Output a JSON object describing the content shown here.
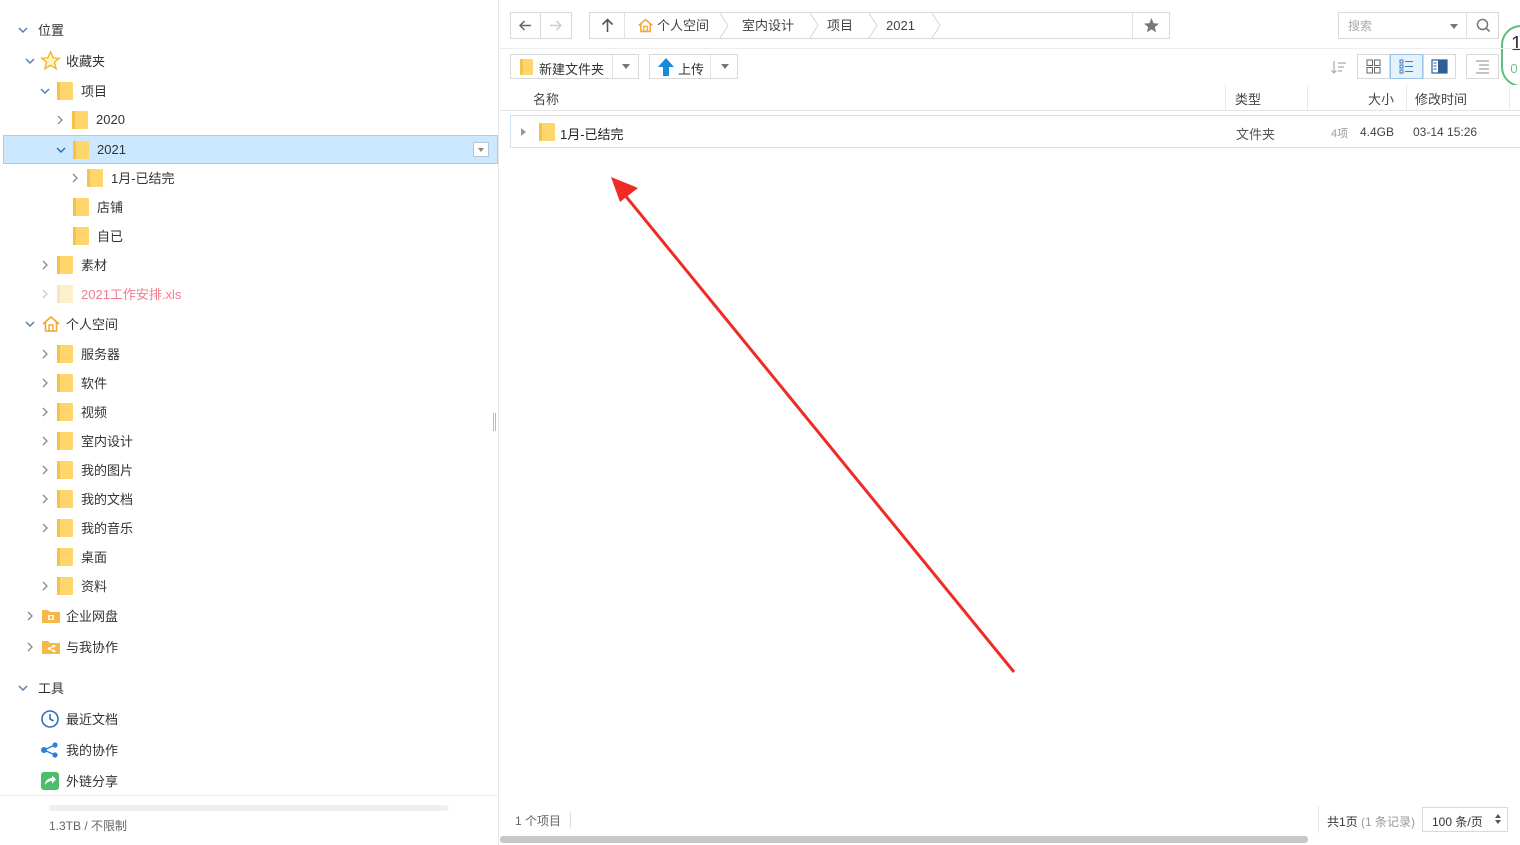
{
  "sidebar": {
    "locations_header": "位置",
    "favorites": "收藏夹",
    "fav_project": "项目",
    "fav_2020": "2020",
    "fav_2021": "2021",
    "fav_jan": "1月-已结完",
    "fav_shop": "店铺",
    "fav_self": "自已",
    "fav_material": "素材",
    "fav_xls": "2021工作安排.xls",
    "personal": "个人空间",
    "p_server": "服务器",
    "p_software": "软件",
    "p_video": "视频",
    "p_interior": "室内设计",
    "p_pictures": "我的图片",
    "p_docs": "我的文档",
    "p_music": "我的音乐",
    "p_desktop": "桌面",
    "p_resources": "资料",
    "enterprise": "企业网盘",
    "shared_with_me": "与我协作",
    "tools_header": "工具",
    "recent_docs": "最近文档",
    "my_collab": "我的协作",
    "external_share": "外链分享",
    "storage": "1.3TB / 不限制"
  },
  "breadcrumb": {
    "home": "个人空间",
    "level1": "室内设计",
    "level2": "项目",
    "level3": "2021"
  },
  "search": {
    "placeholder": "搜索"
  },
  "toolbar": {
    "new_folder": "新建文件夹",
    "upload": "上传"
  },
  "columns": {
    "name": "名称",
    "type": "类型",
    "size": "大小",
    "modified": "修改时间"
  },
  "files": [
    {
      "name": "1月-已结完",
      "type": "文件夹",
      "items": "4项",
      "size": "4.4GB",
      "modified": "03-14 15:26"
    }
  ],
  "footer": {
    "item_count": "1 个项目",
    "pages": "共1页",
    "records": "(1 条记录)",
    "page_size": "100 条/页"
  },
  "avatar_text": "1",
  "colors": {
    "folder": "#ffd66b",
    "selected_bg": "#cce8ff",
    "accent": "#1a8ad8",
    "annotation": "#ee2b24"
  }
}
